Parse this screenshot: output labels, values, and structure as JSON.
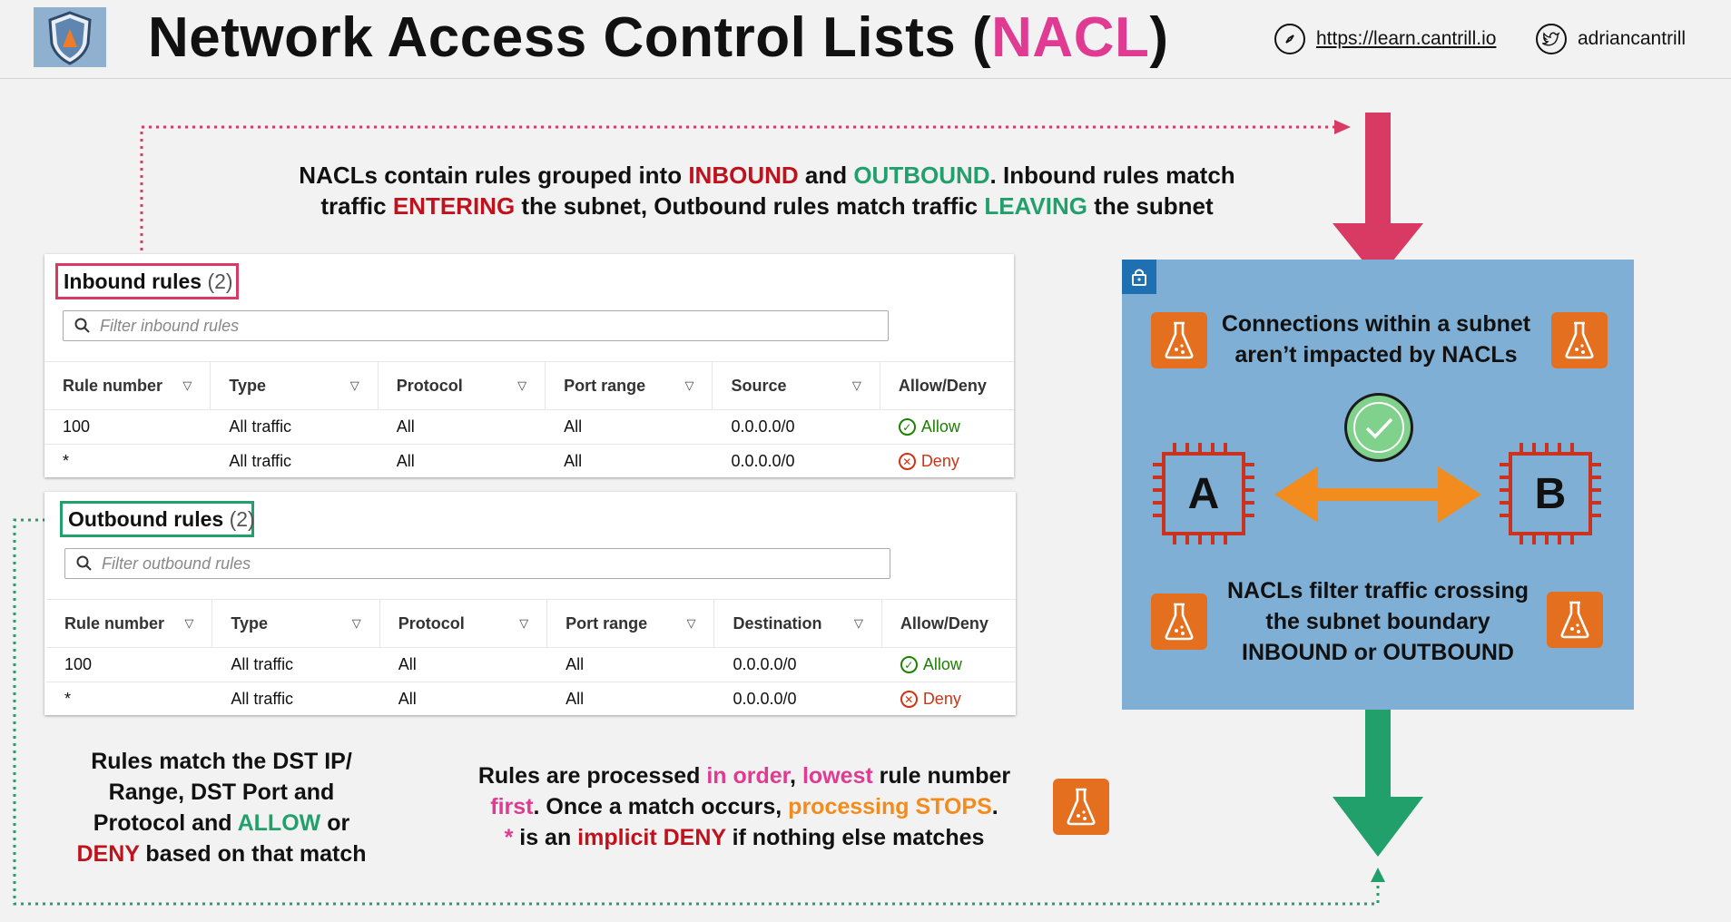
{
  "header": {
    "title_main": "Network Access Control Lists (",
    "title_accent": "NACL",
    "title_close": ")",
    "url": "https://learn.cantrill.io",
    "twitter": "adriancantrill"
  },
  "intro": {
    "p1": "NACLs contain rules grouped into ",
    "inbound": "INBOUND",
    "and": " and ",
    "outbound": "OUTBOUND",
    "p2": ". Inbound rules match traffic ",
    "entering": "ENTERING",
    "p3": " the subnet, Outbound rules match traffic ",
    "leaving": "LEAVING",
    "p4": " the subnet"
  },
  "inbound": {
    "title": "Inbound rules",
    "count": "(2)",
    "filter_placeholder": "Filter inbound rules",
    "columns": [
      "Rule number",
      "Type",
      "Protocol",
      "Port range",
      "Source",
      "Allow/Deny"
    ],
    "rows": [
      {
        "rule": "100",
        "type": "All traffic",
        "protocol": "All",
        "port": "All",
        "addr": "0.0.0.0/0",
        "action": "Allow"
      },
      {
        "rule": "*",
        "type": "All traffic",
        "protocol": "All",
        "port": "All",
        "addr": "0.0.0.0/0",
        "action": "Deny"
      }
    ]
  },
  "outbound": {
    "title": "Outbound rules",
    "count": "(2)",
    "filter_placeholder": "Filter outbound rules",
    "columns": [
      "Rule number",
      "Type",
      "Protocol",
      "Port range",
      "Destination",
      "Allow/Deny"
    ],
    "rows": [
      {
        "rule": "100",
        "type": "All traffic",
        "protocol": "All",
        "port": "All",
        "addr": "0.0.0.0/0",
        "action": "Allow"
      },
      {
        "rule": "*",
        "type": "All traffic",
        "protocol": "All",
        "port": "All",
        "addr": "0.0.0.0/0",
        "action": "Deny"
      }
    ]
  },
  "subnet": {
    "top_text_1": "Connections within a subnet",
    "top_text_2": "aren’t impacted by NACLs",
    "instance_a": "A",
    "instance_b": "B",
    "bottom_text_1": "NACLs filter traffic crossing",
    "bottom_text_2": "the subnet boundary",
    "bottom_text_3": "INBOUND or OUTBOUND"
  },
  "left_note": {
    "l1": "Rules match the DST IP/",
    "l2": "Range, DST Port and",
    "l3a": "Protocol and ",
    "allow": "ALLOW",
    "l3b": " or",
    "deny": "DENY",
    "l4": " based on that match"
  },
  "center_note": {
    "a1": "Rules are processed ",
    "in_order": "in order",
    "a2": ", ",
    "lowest": "lowest",
    "a3": " rule number",
    "first": "first",
    "b1": ". Once a match occurs, ",
    "stops": "processing STOPS",
    "b2": ".",
    "star": "*",
    "c1": " is an ",
    "implicit": "implicit DENY",
    "c2": " if nothing else matches"
  },
  "colors": {
    "pink": "#e03a92",
    "red": "#c0121d",
    "green": "#22a06b",
    "orange": "#f28c1f",
    "inbound_arrow": "#d93a63",
    "outbound_arrow": "#22a06b",
    "subnet_box": "#7fafd4"
  }
}
